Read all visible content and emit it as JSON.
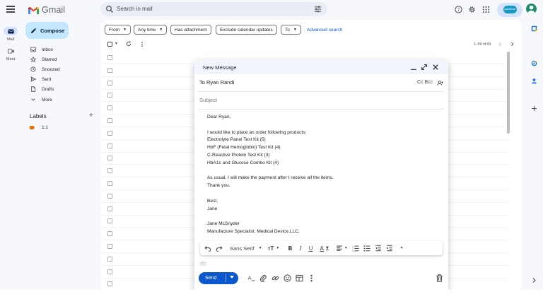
{
  "app": {
    "name": "Gmail"
  },
  "search": {
    "placeholder": "Search in mail"
  },
  "header": {
    "salesforce_badge": "salesforce"
  },
  "rail": {
    "mail_label": "Mail",
    "meet_label": "Meet"
  },
  "sidebar": {
    "compose_label": "Compose",
    "items": [
      {
        "label": "Inbox",
        "icon": "inbox-icon"
      },
      {
        "label": "Starred",
        "icon": "star-icon"
      },
      {
        "label": "Snoozed",
        "icon": "clock-icon"
      },
      {
        "label": "Sent",
        "icon": "send-icon"
      },
      {
        "label": "Drafts",
        "icon": "draft-icon"
      },
      {
        "label": "More",
        "icon": "chevron-down-icon"
      }
    ],
    "labels_title": "Labels",
    "labels_add": "+",
    "labels": [
      {
        "label": "1:1",
        "color": "#e8710a"
      }
    ]
  },
  "filters": {
    "from": "From",
    "any_time": "Any time",
    "has_attachment": "Has attachment",
    "exclude_calendar": "Exclude calendar updates",
    "to": "To",
    "advanced_search": "Advanced search"
  },
  "list": {
    "pager": "1–50 of 69"
  },
  "compose": {
    "title": "New Message",
    "to": "To Ryan Randi",
    "cc_bcc": "Cc Bcc",
    "subject_placeholder": "Subject",
    "body_lines": [
      "Dear Ryan,",
      "",
      "I would like to place an order following products:",
      "Electrolyte Panel Test Kit (5)",
      "HbF (Fetal Hemoglobin) Test Kit (4)",
      "C-Reactive Protein Test Kit (3)",
      "HbA1c and Glucose Combo Kit (4)",
      "",
      "As usual, I will make the payment after I receive all the items.",
      "Thank you.",
      "",
      "Best,",
      "Jane",
      "",
      "Jane McSnyder",
      "Manufacture Specialist. Medical Device.LLC."
    ],
    "font_name": "Sans Serif",
    "send_label": "Send",
    "more_dots": "···"
  },
  "colors": {
    "accent": "#0b57d0",
    "compose_bg": "#c2e7ff",
    "label_orange": "#e8710a"
  }
}
